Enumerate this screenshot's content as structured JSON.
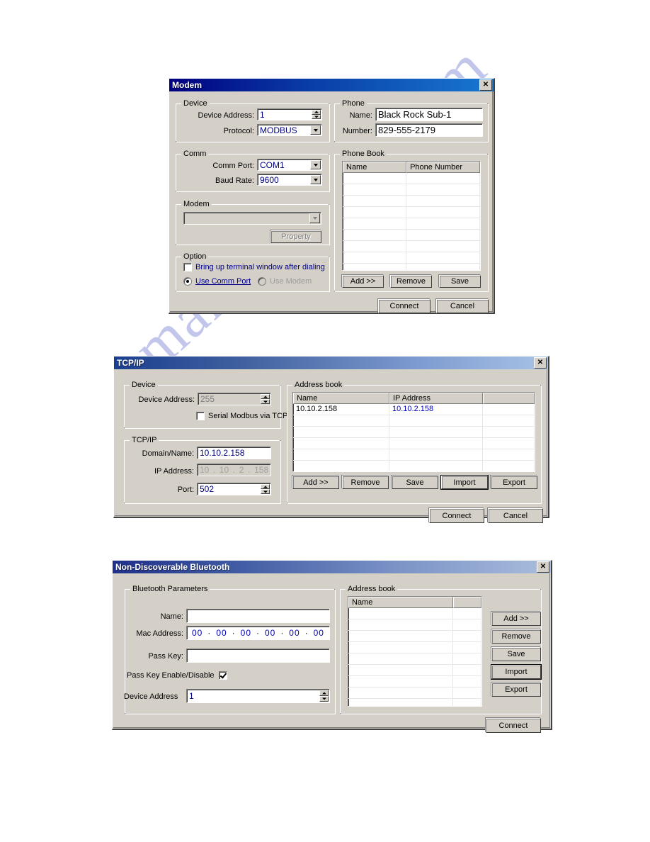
{
  "page": {
    "watermark": "manualshive.com"
  },
  "modem_dialog": {
    "title": "Modem",
    "close_icon": "close-icon",
    "device_group": {
      "legend": "Device",
      "device_address_label": "Device Address:",
      "device_address_value": "1",
      "protocol_label": "Protocol:",
      "protocol_value": "MODBUS"
    },
    "comm_group": {
      "legend": "Comm",
      "comm_port_label": "Comm Port:",
      "comm_port_value": "COM1",
      "baud_rate_label": "Baud Rate:",
      "baud_rate_value": "9600"
    },
    "modem_group": {
      "legend": "Modem",
      "modem_select_value": "",
      "property_button": "Property"
    },
    "option_group": {
      "legend": "Option",
      "terminal_checkbox_label": "Bring up terminal window after dialing",
      "terminal_checked": false,
      "use_comm_port_label": "Use Comm Port",
      "use_modem_label": "Use Modem",
      "selected_radio": "Use Comm Port"
    },
    "phone_group": {
      "legend": "Phone",
      "name_label": "Name:",
      "name_value": "Black Rock Sub-1",
      "number_label": "Number:",
      "number_value": "829-555-2179"
    },
    "phone_book": {
      "legend": "Phone Book",
      "columns": [
        "Name",
        "Phone Number"
      ],
      "rows": [],
      "empty_row_count": 11,
      "buttons": [
        "Add >>",
        "Remove",
        "Save"
      ]
    },
    "footer_buttons": [
      "Connect",
      "Cancel"
    ]
  },
  "tcpip_dialog": {
    "title": "TCP/IP",
    "close_icon": "close-icon",
    "device_group": {
      "legend": "Device",
      "device_address_label": "Device Address:",
      "device_address_value": "255",
      "device_address_disabled": true,
      "serial_modbus_label": "Serial Modbus via TCP",
      "serial_modbus_checked": false
    },
    "tcpip_group": {
      "legend": "TCP/IP",
      "domain_label": "Domain/Name:",
      "domain_value": "10.10.2.158",
      "ip_label": "IP Address:",
      "ip_octets": [
        "10",
        "10",
        "2",
        "158"
      ],
      "port_label": "Port:",
      "port_value": "502"
    },
    "address_book": {
      "legend": "Address book",
      "columns": [
        "Name",
        "IP Address",
        ""
      ],
      "rows": [
        {
          "name": "10.10.2.158",
          "ip": "10.10.2.158",
          "extra": ""
        }
      ],
      "empty_row_count": 6,
      "buttons": [
        "Add  >>",
        "Remove",
        "Save",
        "Import",
        "Export"
      ],
      "default_button": "Import"
    },
    "footer_buttons": [
      "Connect",
      "Cancel"
    ]
  },
  "bluetooth_dialog": {
    "title": "Non-Discoverable Bluetooth",
    "close_icon": "close-icon",
    "parameters_group": {
      "legend": "Bluetooth Parameters",
      "name_label": "Name:",
      "name_value": "",
      "mac_label": "Mac Address:",
      "mac_octets": [
        "00",
        "00",
        "00",
        "00",
        "00",
        "00"
      ],
      "pass_key_label": "Pass Key:",
      "pass_key_value": "",
      "pass_key_enable_label": "Pass Key Enable/Disable",
      "pass_key_enable_checked": true,
      "device_address_label": "Device Address",
      "device_address_value": "1"
    },
    "address_book": {
      "legend": "Address book",
      "columns": [
        "Name",
        ""
      ],
      "rows": [],
      "empty_row_count": 9,
      "buttons": [
        "Add  >>",
        "Remove",
        "Save",
        "Import",
        "Export"
      ],
      "default_button": "Import"
    },
    "footer_buttons": [
      "Connect"
    ]
  }
}
